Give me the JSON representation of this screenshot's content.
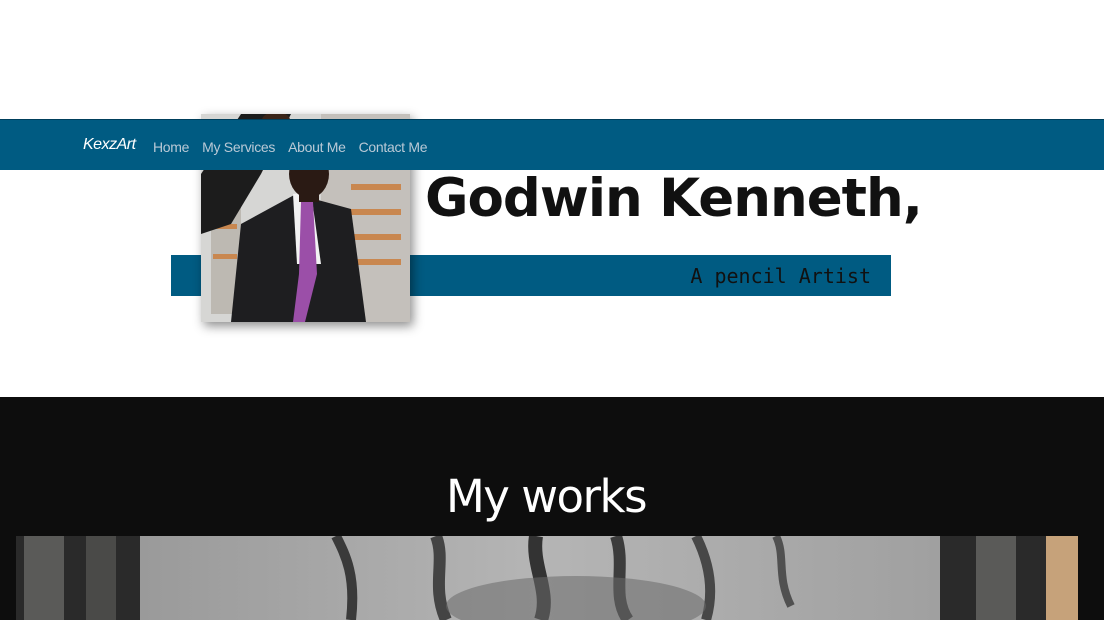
{
  "navbar": {
    "brand": "KexzArt",
    "links": [
      {
        "label": "Home"
      },
      {
        "label": "My Services"
      },
      {
        "label": "About Me"
      },
      {
        "label": "Contact Me"
      }
    ]
  },
  "hero": {
    "name": "Godwin Kenneth,",
    "subtitle": "A pencil Artist",
    "portrait_alt": "portrait-photo"
  },
  "works": {
    "title": "My works"
  },
  "colors": {
    "accent": "#005b82",
    "dark_section": "#0d0d0d",
    "nav_link": "#b9c9d6"
  }
}
